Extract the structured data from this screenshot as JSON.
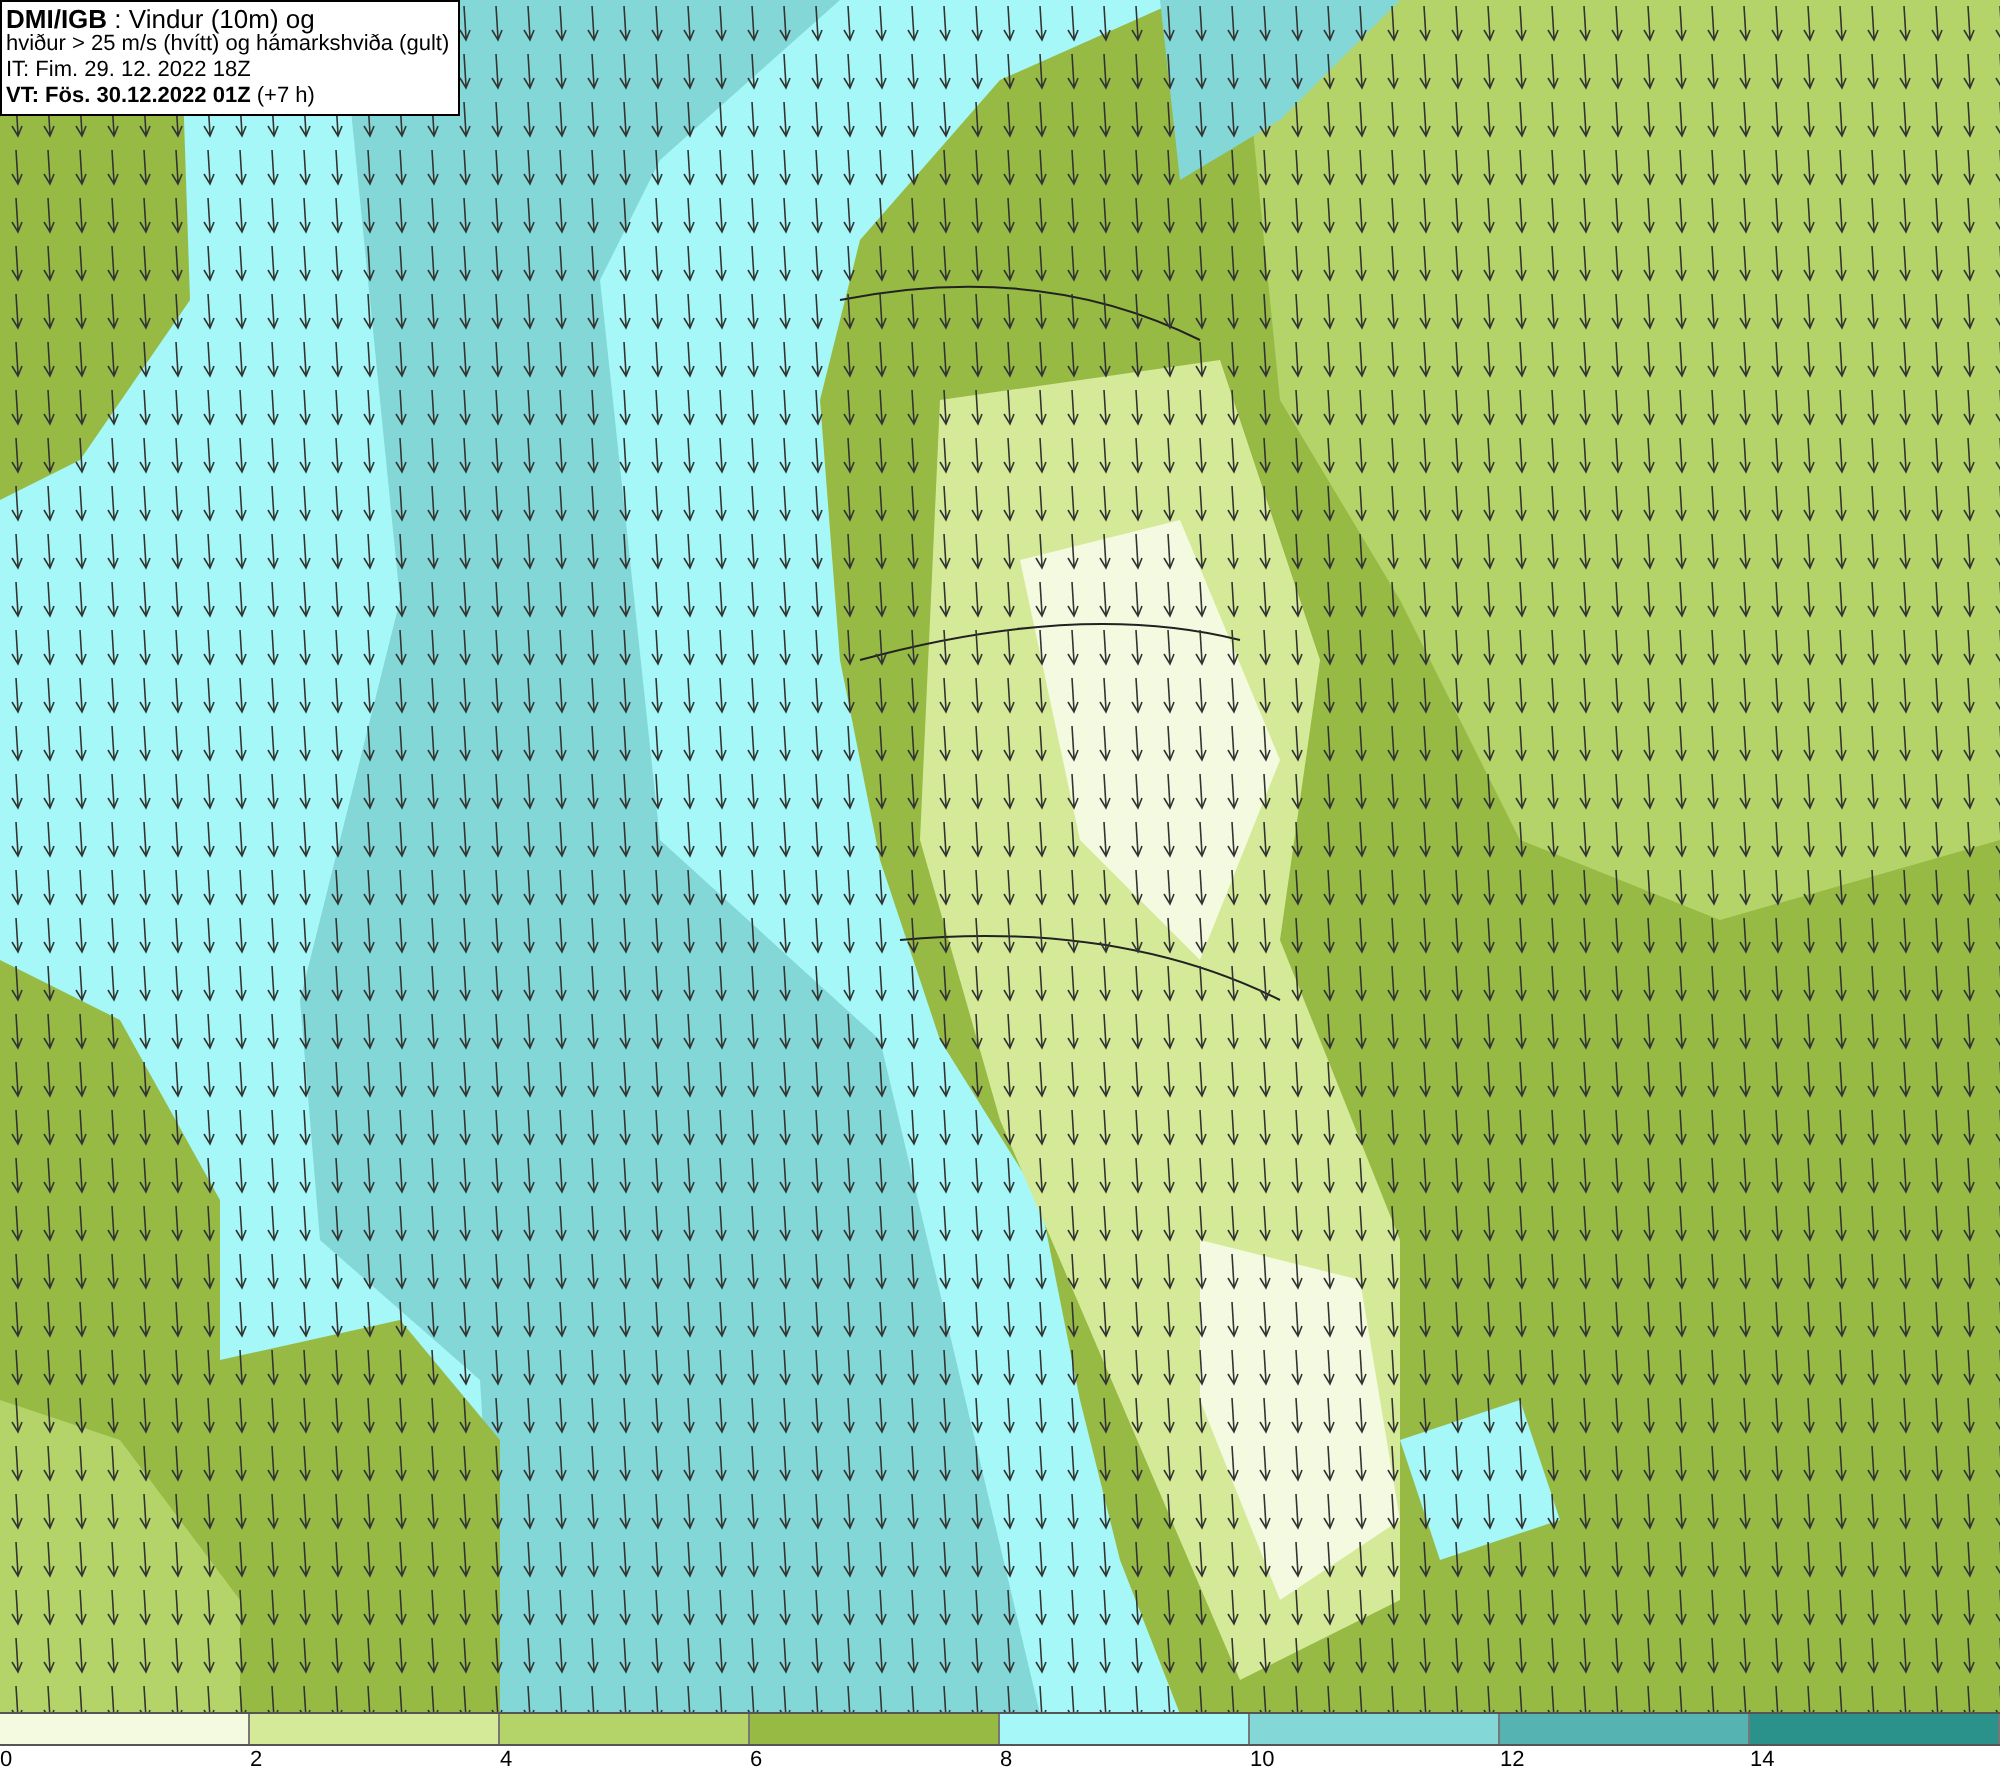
{
  "info_box": {
    "lines": [
      "**DMI/IGB** : Vindur (10m) og",
      "hviður > 25 m/s (hvítt) og hámarkshviða (gult)",
      "IT: Fim. 29. 12. 2022 18Z",
      "**VT: Fös. 30.12.2022 01Z** (+7 h)"
    ]
  },
  "legend": {
    "bins": [
      {
        "color": "#f4fadf"
      },
      {
        "color": "#d5ea98"
      },
      {
        "color": "#b4d46a"
      },
      {
        "color": "#96ba44"
      },
      {
        "color": "#a6f7f7"
      },
      {
        "color": "#84d7d7"
      },
      {
        "color": "#55b3b2"
      },
      {
        "color": "#2b918b"
      }
    ],
    "ticks": [
      "0",
      "2",
      "4",
      "6",
      "8",
      "10",
      "12",
      "14"
    ]
  }
}
